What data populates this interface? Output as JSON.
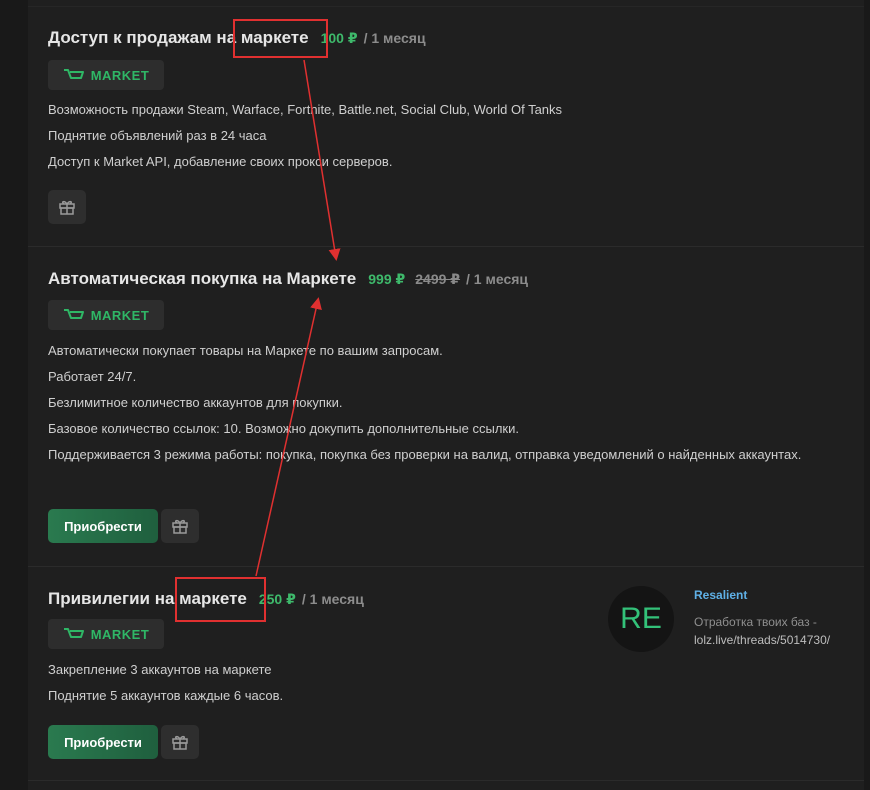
{
  "brand": {
    "accent": "#3eb96b",
    "badge_text_color": "#2fb766",
    "link_color": "#5fb0e6",
    "annotation_color": "#e03030"
  },
  "products": [
    {
      "title": "Доступ к продажам на маркете",
      "price": "100 ₽",
      "old_price": "",
      "period": "/ 1 месяц",
      "badge": "MARKET",
      "lines": [
        "Возможность продажи Steam, Warface, Fortnite, Battle.net, Social Club, World Of Tanks",
        "Поднятие объявлений раз в 24 часа",
        "Доступ к Market API, добавление своих прокси серверов."
      ],
      "buy_label": "",
      "gift_icon": "gift-icon"
    },
    {
      "title": "Автоматическая покупка на Маркете",
      "price": "999 ₽",
      "old_price": "2499 ₽",
      "period": "/ 1 месяц",
      "badge": "MARKET",
      "lines": [
        "Автоматически покупает товары на Маркете по вашим запросам.",
        "Работает 24/7.",
        "Безлимитное количество аккаунтов для покупки.",
        "Базовое количество ссылок: 10. Возможно докупить дополнительные ссылки.",
        "Поддерживается 3 режима работы: покупка, покупка без проверки на валид, отправка уведомлений о найденных аккаунтах."
      ],
      "buy_label": "Приобрести",
      "gift_icon": "gift-icon"
    },
    {
      "title": "Привилегии на маркете",
      "price": "250 ₽",
      "old_price": "",
      "period": "/ 1 месяц",
      "badge": "MARKET",
      "lines": [
        "Закрепление 3 аккаунтов на маркете",
        "Поднятие 5 аккаунтов каждые 6 часов."
      ],
      "buy_label": "Приобрести",
      "gift_icon": "gift-icon"
    }
  ],
  "user_card": {
    "avatar_initials": "RE",
    "name": "Resalient",
    "status_prefix": "Отработка твоих баз -",
    "status_link": "lolz.live/threads/5014730/"
  }
}
